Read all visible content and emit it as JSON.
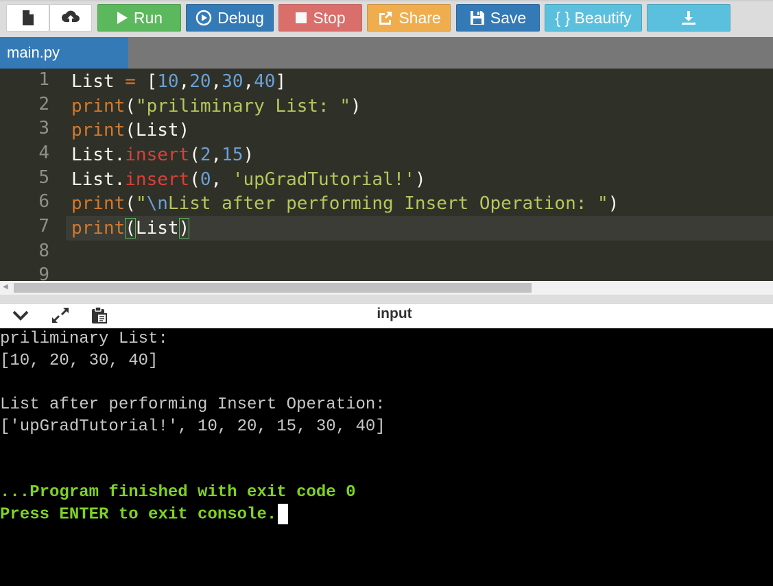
{
  "toolbar": {
    "run_label": "Run",
    "debug_label": "Debug",
    "stop_label": "Stop",
    "share_label": "Share",
    "save_label": "Save",
    "beautify_label": "{ } Beautify"
  },
  "tabs": [
    {
      "label": "main.py"
    }
  ],
  "editor": {
    "line_numbers": [
      "1",
      "2",
      "3",
      "4",
      "5",
      "6",
      "7",
      "8",
      "9"
    ],
    "active_line": 7
  },
  "console": {
    "title": "input",
    "output": [
      "priliminary List:",
      "[10, 20, 30, 40]",
      "",
      "List after performing Insert Operation:",
      "['upGradTutorial!', 10, 20, 15, 30, 40]"
    ],
    "finish_line": "...Program finished with exit code 0",
    "press_line": "Press ENTER to exit console."
  },
  "colors": {
    "run": "#5cb85c",
    "debug": "#337ab7",
    "stop": "#d9534f",
    "share": "#f0ad4e",
    "save": "#337ab7",
    "beautify": "#5bc0de",
    "console_success": "#7ed321"
  },
  "icons": [
    "new-file-icon",
    "upload-icon",
    "play-icon",
    "debug-icon",
    "stop-icon",
    "share-icon",
    "save-icon",
    "download-icon",
    "chevron-down-icon",
    "expand-icon",
    "clipboard-icon"
  ]
}
